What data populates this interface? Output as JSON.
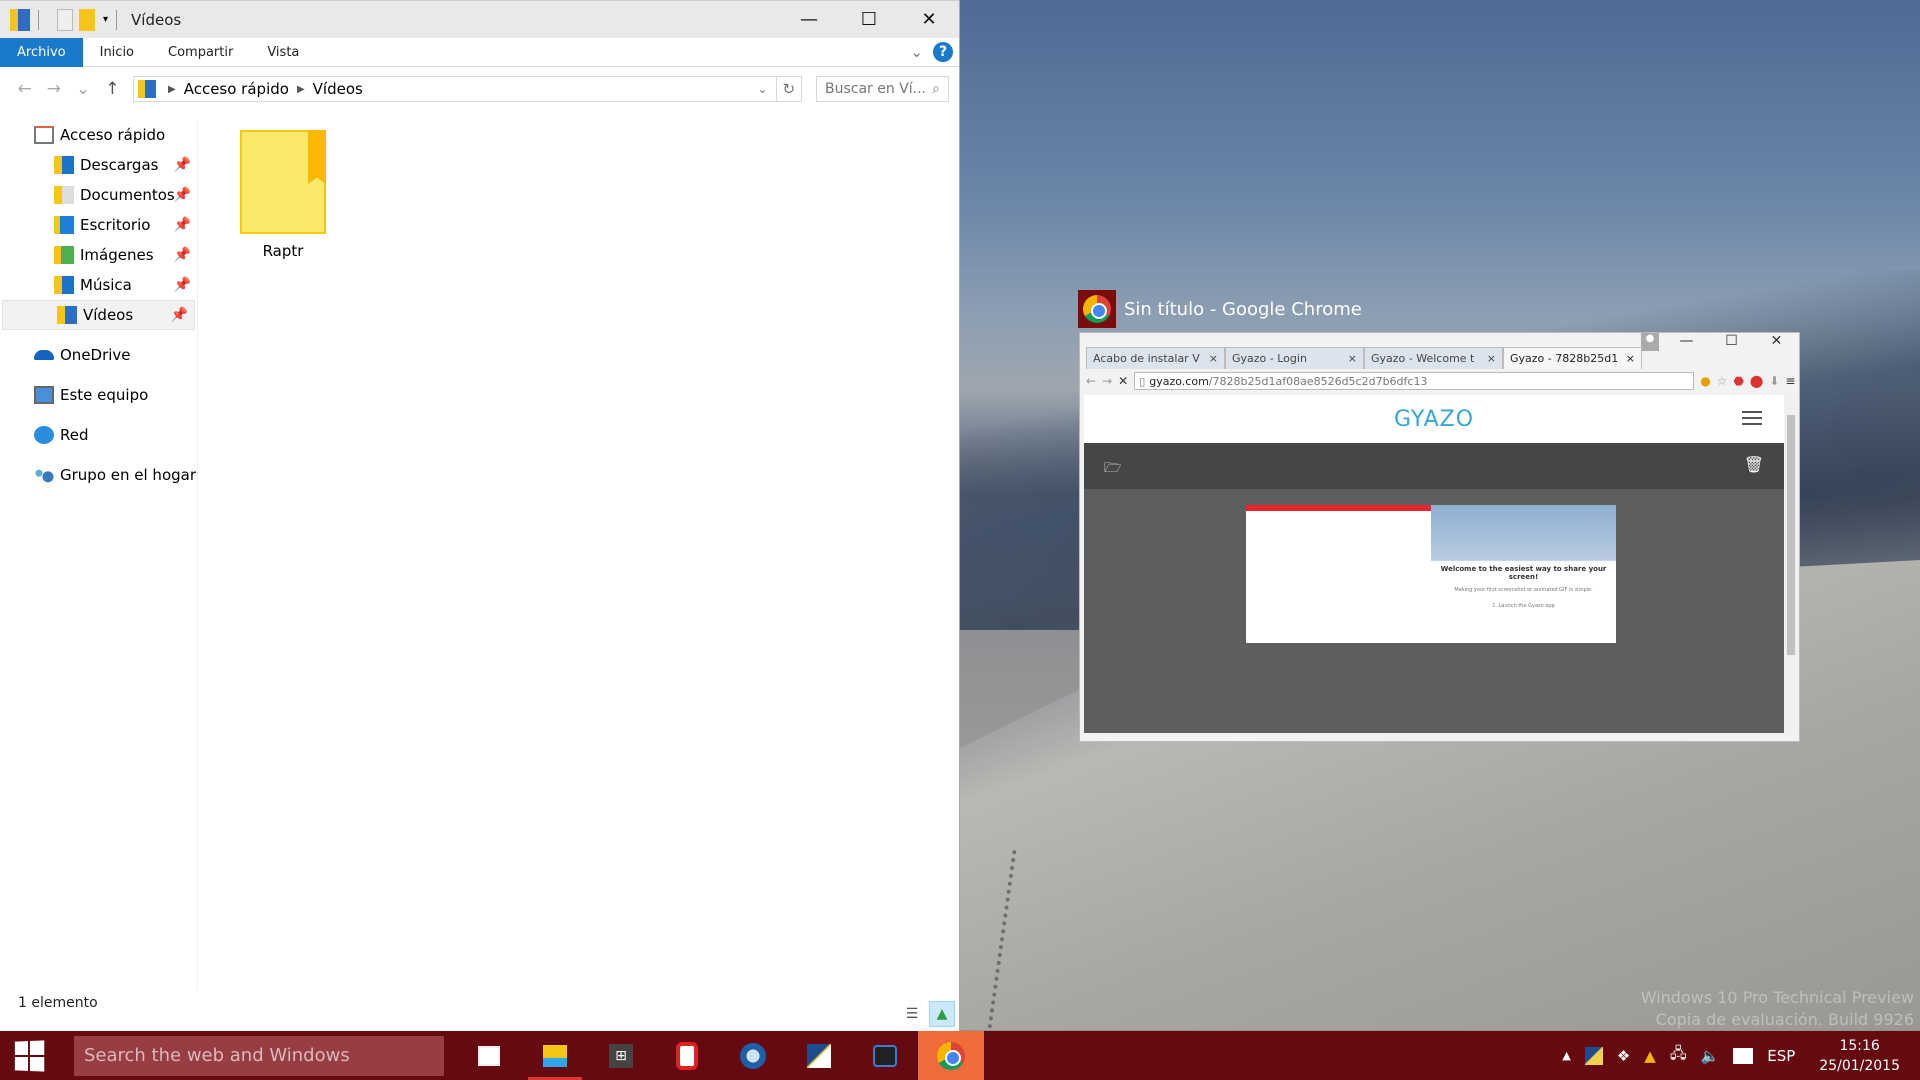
{
  "explorer": {
    "title": "Vídeos",
    "window_controls": {
      "minimize": "—",
      "maximize": "☐",
      "close": "✕"
    },
    "ribbon_tabs": [
      "Archivo",
      "Inicio",
      "Compartir",
      "Vista"
    ],
    "help_label": "?",
    "nav_buttons": {
      "back": "←",
      "forward": "→",
      "recent": "⌄",
      "up": "↑"
    },
    "breadcrumb": [
      "Acceso rápido",
      "Vídeos"
    ],
    "search_placeholder": "Buscar en Ví...",
    "nav_pane": {
      "quick_access": "Acceso rápido",
      "pinned": [
        "Descargas",
        "Documentos",
        "Escritorio",
        "Imágenes",
        "Música",
        "Vídeos"
      ],
      "selected": "Vídeos",
      "roots": [
        "OneDrive",
        "Este equipo",
        "Red",
        "Grupo en el hogar"
      ]
    },
    "items": [
      {
        "name": "Raptr",
        "type": "folder"
      }
    ],
    "status": "1 elemento"
  },
  "chrome_thumbnail": {
    "title": "Sin título - Google Chrome",
    "tabs": [
      {
        "label": "Acabo de instalar V",
        "active": false
      },
      {
        "label": "Gyazo - Login",
        "active": false
      },
      {
        "label": "Gyazo - Welcome t",
        "active": false
      },
      {
        "label": "Gyazo - 7828b25d1",
        "active": true
      }
    ],
    "url_host": "gyazo.com",
    "url_path": "/7828b25d1af08ae8526d5c2d7b6dfc13",
    "page": {
      "logo": "GYAZO",
      "embedded_text": "Welcome to the easiest way to share your screen!",
      "embedded_subtext": "Making your first screenshot or animated GIF is simple.",
      "embedded_step": "1. Launch the Gyazo app"
    }
  },
  "desktop": {
    "watermark_line1": "Windows 10 Pro Technical Preview",
    "watermark_line2": "Copia de evaluación. Build 9926"
  },
  "taskbar": {
    "search_placeholder": "Search the web and Windows",
    "apps": [
      "task-view",
      "file-explorer",
      "store",
      "camera-app",
      "thunderbird",
      "paint-app",
      "media-app",
      "chrome"
    ],
    "language": "ESP",
    "time": "15:16",
    "date": "25/01/2015"
  },
  "colors": {
    "accent": "#1979ca",
    "taskbar": "#650a11",
    "gyazo": "#35a7d6"
  }
}
